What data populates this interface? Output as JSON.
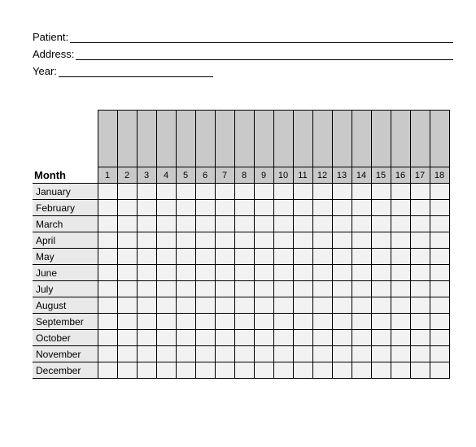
{
  "fields": {
    "patient_label": "Patient:",
    "address_label": "Address:",
    "year_label": "Year:"
  },
  "table": {
    "month_header": "Month",
    "columns": [
      "1",
      "2",
      "3",
      "4",
      "5",
      "6",
      "7",
      "8",
      "9",
      "10",
      "11",
      "12",
      "13",
      "14",
      "15",
      "16",
      "17",
      "18"
    ],
    "months": [
      "January",
      "February",
      "March",
      "April",
      "May",
      "June",
      "July",
      "August",
      "September",
      "October",
      "November",
      "December"
    ]
  }
}
